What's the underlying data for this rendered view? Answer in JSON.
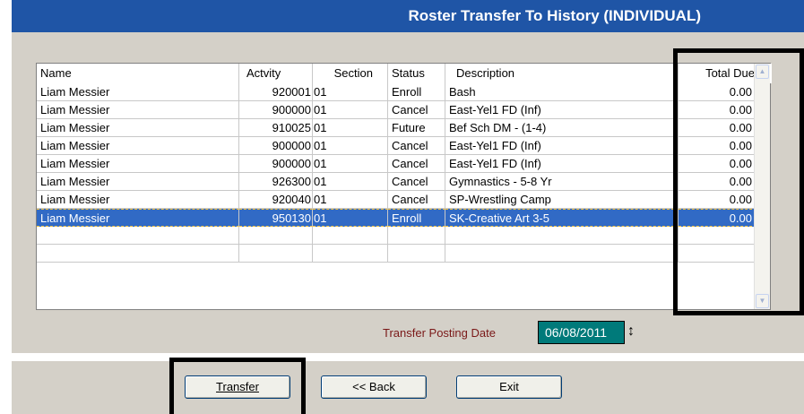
{
  "window": {
    "title": "Roster Transfer To History (INDIVIDUAL)"
  },
  "grid": {
    "columns": [
      "Name",
      "Actvity",
      "Section",
      "Status",
      "Description",
      "Total Due"
    ],
    "rows": [
      {
        "name": "Liam Messier",
        "activity": "920001",
        "section": "01",
        "status": "Enroll",
        "description": "Bash",
        "total_due": "0.00"
      },
      {
        "name": "Liam Messier",
        "activity": "900000",
        "section": "01",
        "status": "Cancel",
        "description": "East-Yel1 FD (Inf)",
        "total_due": "0.00"
      },
      {
        "name": "Liam Messier",
        "activity": "910025",
        "section": "01",
        "status": "Future",
        "description": "Bef Sch DM - (1-4)",
        "total_due": "0.00"
      },
      {
        "name": "Liam Messier",
        "activity": "900000",
        "section": "01",
        "status": "Cancel",
        "description": "East-Yel1 FD (Inf)",
        "total_due": "0.00"
      },
      {
        "name": "Liam Messier",
        "activity": "900000",
        "section": "01",
        "status": "Cancel",
        "description": "East-Yel1 FD (Inf)",
        "total_due": "0.00"
      },
      {
        "name": "Liam Messier",
        "activity": "926300",
        "section": "01",
        "status": "Cancel",
        "description": "Gymnastics - 5-8 Yr",
        "total_due": "0.00"
      },
      {
        "name": "Liam Messier",
        "activity": "920040",
        "section": "01",
        "status": "Cancel",
        "description": "SP-Wrestling Camp",
        "total_due": "0.00"
      },
      {
        "name": "Liam Messier",
        "activity": "950130",
        "section": "01",
        "status": "Enroll",
        "description": "SK-Creative Art 3-5",
        "total_due": "0.00"
      }
    ],
    "selected_row": 7,
    "scroll_up_icon": "chevron-up-icon",
    "scroll_down_icon": "chevron-down-icon"
  },
  "transfer_posting": {
    "label": "Transfer Posting Date",
    "date": "06/08/2011",
    "spin_icon": "up-down-arrow-icon"
  },
  "buttons": {
    "transfer": "Transfer",
    "back": "<< Back",
    "exit": "Exit"
  },
  "colors": {
    "title_bar": "#1f55a6",
    "selection": "#316ac5",
    "date_field": "#007a7a",
    "label": "#7a1818"
  }
}
